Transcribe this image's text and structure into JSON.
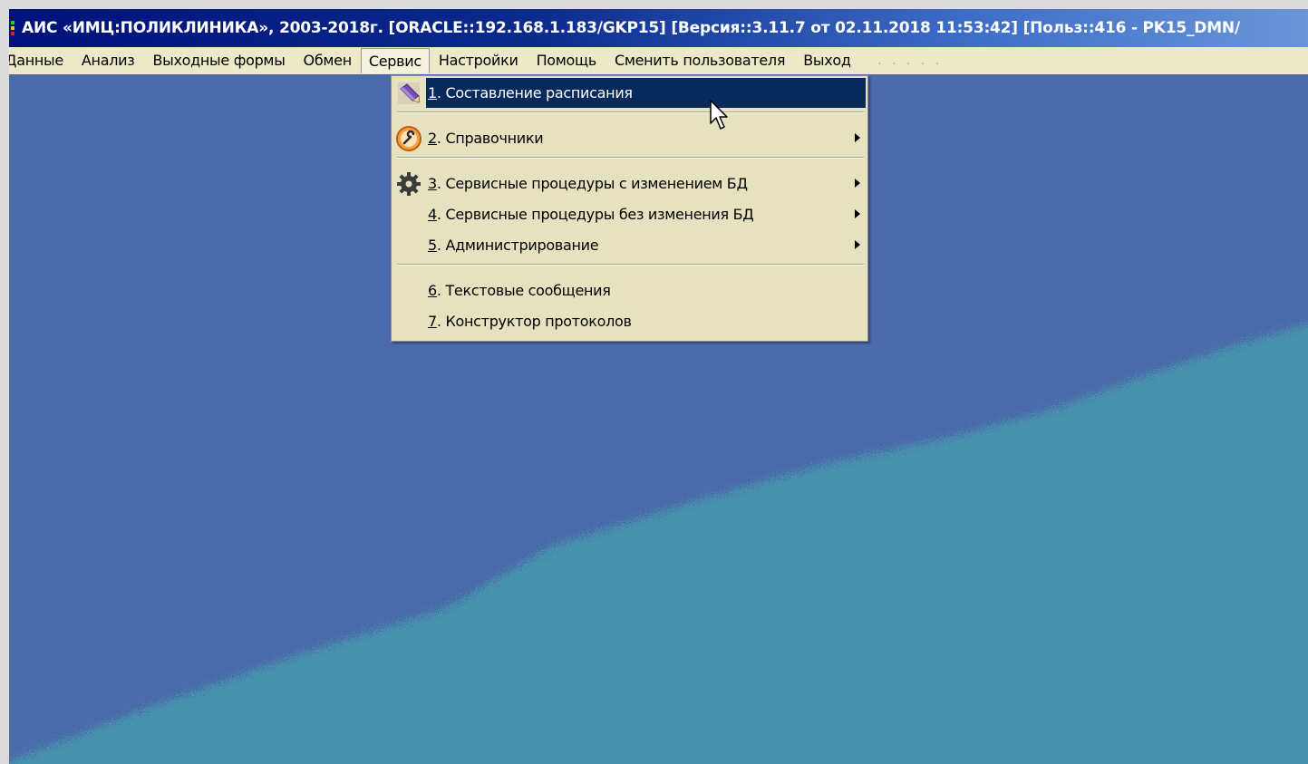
{
  "window": {
    "title": "АИС «ИМЦ:ПОЛИКЛИНИКА», 2003-2018г. [ORACLE::192.168.1.183/GKP15] [Версия::3.11.7 от 02.11.2018 11:53:42] [Польз::416 - PK15_DMN/"
  },
  "menubar": {
    "items": [
      {
        "label": "Данные"
      },
      {
        "label": "Анализ"
      },
      {
        "label": "Выходные формы"
      },
      {
        "label": "Обмен"
      },
      {
        "label": "Сервис"
      },
      {
        "label": "Настройки"
      },
      {
        "label": "Помощь"
      },
      {
        "label": "Сменить пользователя"
      },
      {
        "label": "Выход"
      }
    ],
    "active": "Сервис"
  },
  "service_menu": {
    "items": [
      {
        "num": "1",
        "text": ". Составление расписания",
        "icon": "schedule-pencil-icon",
        "submenu": false,
        "selected": true
      },
      {
        "num": "2",
        "text": ". Справочники",
        "icon": "wrench-circle-icon",
        "submenu": true
      },
      {
        "num": "3",
        "text": ". Сервисные процедуры с изменением БД",
        "icon": "gear-icon",
        "submenu": true
      },
      {
        "num": "4",
        "text": ". Сервисные процедуры без изменения БД",
        "icon": "",
        "submenu": true
      },
      {
        "num": "5",
        "text": ". Администрирование",
        "icon": "",
        "submenu": true
      },
      {
        "num": "6",
        "text": ". Текстовые сообщения",
        "icon": "",
        "submenu": false
      },
      {
        "num": "7",
        "text": ". Конструктор протоколов",
        "icon": "",
        "submenu": false
      }
    ]
  },
  "colors": {
    "desktop_blue": "#4a6aab",
    "desktop_teal": "#4692ad",
    "menu_bg": "#ece9c8",
    "highlight": "#062a5c"
  }
}
